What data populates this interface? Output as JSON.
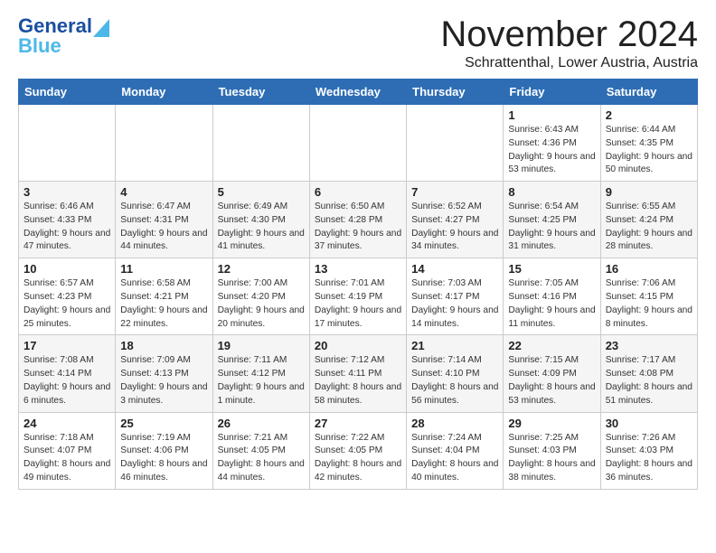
{
  "logo": {
    "general": "General",
    "blue": "Blue"
  },
  "header": {
    "month": "November 2024",
    "subtitle": "Schrattenthal, Lower Austria, Austria"
  },
  "days_of_week": [
    "Sunday",
    "Monday",
    "Tuesday",
    "Wednesday",
    "Thursday",
    "Friday",
    "Saturday"
  ],
  "weeks": [
    [
      {
        "day": "",
        "info": ""
      },
      {
        "day": "",
        "info": ""
      },
      {
        "day": "",
        "info": ""
      },
      {
        "day": "",
        "info": ""
      },
      {
        "day": "",
        "info": ""
      },
      {
        "day": "1",
        "info": "Sunrise: 6:43 AM\nSunset: 4:36 PM\nDaylight: 9 hours and 53 minutes."
      },
      {
        "day": "2",
        "info": "Sunrise: 6:44 AM\nSunset: 4:35 PM\nDaylight: 9 hours and 50 minutes."
      }
    ],
    [
      {
        "day": "3",
        "info": "Sunrise: 6:46 AM\nSunset: 4:33 PM\nDaylight: 9 hours and 47 minutes."
      },
      {
        "day": "4",
        "info": "Sunrise: 6:47 AM\nSunset: 4:31 PM\nDaylight: 9 hours and 44 minutes."
      },
      {
        "day": "5",
        "info": "Sunrise: 6:49 AM\nSunset: 4:30 PM\nDaylight: 9 hours and 41 minutes."
      },
      {
        "day": "6",
        "info": "Sunrise: 6:50 AM\nSunset: 4:28 PM\nDaylight: 9 hours and 37 minutes."
      },
      {
        "day": "7",
        "info": "Sunrise: 6:52 AM\nSunset: 4:27 PM\nDaylight: 9 hours and 34 minutes."
      },
      {
        "day": "8",
        "info": "Sunrise: 6:54 AM\nSunset: 4:25 PM\nDaylight: 9 hours and 31 minutes."
      },
      {
        "day": "9",
        "info": "Sunrise: 6:55 AM\nSunset: 4:24 PM\nDaylight: 9 hours and 28 minutes."
      }
    ],
    [
      {
        "day": "10",
        "info": "Sunrise: 6:57 AM\nSunset: 4:23 PM\nDaylight: 9 hours and 25 minutes."
      },
      {
        "day": "11",
        "info": "Sunrise: 6:58 AM\nSunset: 4:21 PM\nDaylight: 9 hours and 22 minutes."
      },
      {
        "day": "12",
        "info": "Sunrise: 7:00 AM\nSunset: 4:20 PM\nDaylight: 9 hours and 20 minutes."
      },
      {
        "day": "13",
        "info": "Sunrise: 7:01 AM\nSunset: 4:19 PM\nDaylight: 9 hours and 17 minutes."
      },
      {
        "day": "14",
        "info": "Sunrise: 7:03 AM\nSunset: 4:17 PM\nDaylight: 9 hours and 14 minutes."
      },
      {
        "day": "15",
        "info": "Sunrise: 7:05 AM\nSunset: 4:16 PM\nDaylight: 9 hours and 11 minutes."
      },
      {
        "day": "16",
        "info": "Sunrise: 7:06 AM\nSunset: 4:15 PM\nDaylight: 9 hours and 8 minutes."
      }
    ],
    [
      {
        "day": "17",
        "info": "Sunrise: 7:08 AM\nSunset: 4:14 PM\nDaylight: 9 hours and 6 minutes."
      },
      {
        "day": "18",
        "info": "Sunrise: 7:09 AM\nSunset: 4:13 PM\nDaylight: 9 hours and 3 minutes."
      },
      {
        "day": "19",
        "info": "Sunrise: 7:11 AM\nSunset: 4:12 PM\nDaylight: 9 hours and 1 minute."
      },
      {
        "day": "20",
        "info": "Sunrise: 7:12 AM\nSunset: 4:11 PM\nDaylight: 8 hours and 58 minutes."
      },
      {
        "day": "21",
        "info": "Sunrise: 7:14 AM\nSunset: 4:10 PM\nDaylight: 8 hours and 56 minutes."
      },
      {
        "day": "22",
        "info": "Sunrise: 7:15 AM\nSunset: 4:09 PM\nDaylight: 8 hours and 53 minutes."
      },
      {
        "day": "23",
        "info": "Sunrise: 7:17 AM\nSunset: 4:08 PM\nDaylight: 8 hours and 51 minutes."
      }
    ],
    [
      {
        "day": "24",
        "info": "Sunrise: 7:18 AM\nSunset: 4:07 PM\nDaylight: 8 hours and 49 minutes."
      },
      {
        "day": "25",
        "info": "Sunrise: 7:19 AM\nSunset: 4:06 PM\nDaylight: 8 hours and 46 minutes."
      },
      {
        "day": "26",
        "info": "Sunrise: 7:21 AM\nSunset: 4:05 PM\nDaylight: 8 hours and 44 minutes."
      },
      {
        "day": "27",
        "info": "Sunrise: 7:22 AM\nSunset: 4:05 PM\nDaylight: 8 hours and 42 minutes."
      },
      {
        "day": "28",
        "info": "Sunrise: 7:24 AM\nSunset: 4:04 PM\nDaylight: 8 hours and 40 minutes."
      },
      {
        "day": "29",
        "info": "Sunrise: 7:25 AM\nSunset: 4:03 PM\nDaylight: 8 hours and 38 minutes."
      },
      {
        "day": "30",
        "info": "Sunrise: 7:26 AM\nSunset: 4:03 PM\nDaylight: 8 hours and 36 minutes."
      }
    ]
  ]
}
